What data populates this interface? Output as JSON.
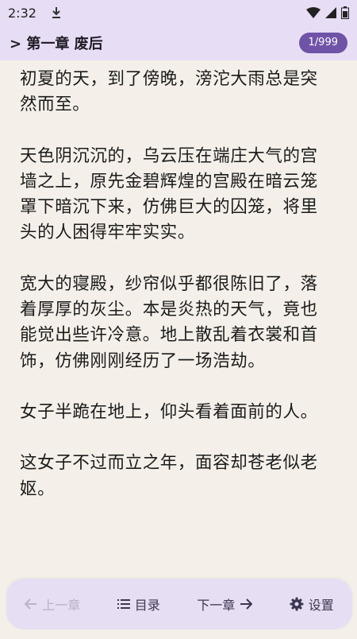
{
  "status_bar": {
    "time": "2:32",
    "icons": [
      "download-icon",
      "wifi-icon",
      "signal-icon",
      "battery-icon"
    ]
  },
  "header": {
    "chapter_title": "> 第一章 废后",
    "page_indicator": "1/999",
    "badge_color": "#6f53a7"
  },
  "content": {
    "paragraphs": [
      "初夏的天，到了傍晚，滂沱大雨总是突然而至。",
      "天色阴沉沉的，乌云压在端庄大气的宫墙之上，原先金碧辉煌的宫殿在暗云笼罩下暗沉下来，仿佛巨大的囚笼，将里头的人困得牢牢实实。",
      "宽大的寝殿，纱帘似乎都很陈旧了，落着厚厚的灰尘。本是炎热的天气，竟也能觉出些许冷意。地上散乱着衣裳和首饰，仿佛刚刚经历了一场浩劫。",
      "女子半跪在地上，仰头看着面前的人。",
      "这女子不过而立之年，面容却苍老似老妪。"
    ]
  },
  "bottom_nav": {
    "prev_label": "上一章",
    "toc_label": "目录",
    "next_label": "下一章",
    "settings_label": "设置"
  }
}
